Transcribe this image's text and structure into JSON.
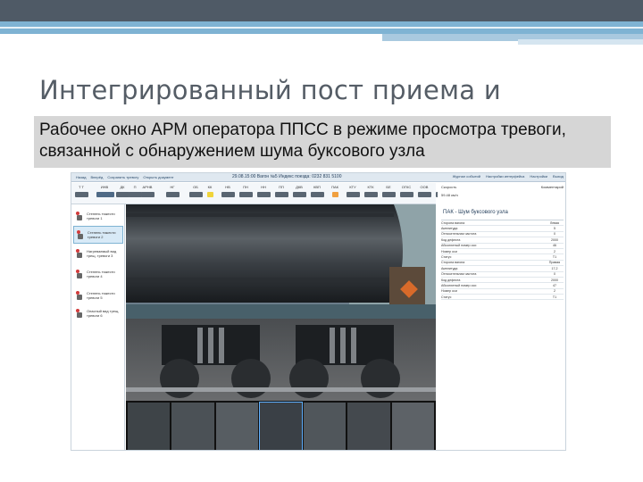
{
  "slide": {
    "title": "Интегрированный пост приема и",
    "subtitle_lines": [
      "Рабочее окно АРМ оператора ППСС в режиме просмотра тревоги,",
      "связанной с обнаружением шума буксового узла"
    ]
  },
  "app": {
    "title": "29.08.15:00 Вагон №5 Индекс поезда: 0232 831 5100",
    "toolbar_buttons": [
      "Назад",
      "Вперёд",
      "Сохранить тревогу",
      "Открыть документ"
    ],
    "toolbar_right": [
      "Журнал событий",
      "Настройки интерфейса",
      "Настройки",
      "Выход"
    ],
    "sensors": [
      {
        "label": "Т Т",
        "value": "dark"
      },
      {
        "label": "ИНВ",
        "value": "wide"
      },
      {
        "label": "ДК",
        "value": "dark"
      },
      {
        "label": "П",
        "value": "dark"
      },
      {
        "label": "АРНВ",
        "value": "dark"
      },
      {
        "label": "НГ",
        "value": "dark"
      },
      {
        "label": "ОБ",
        "value": "dark"
      },
      {
        "label": "КК",
        "value": "yellow"
      },
      {
        "label": "НВ",
        "value": "dark"
      },
      {
        "label": "ПН",
        "value": "dark"
      },
      {
        "label": "НН",
        "value": "dark"
      },
      {
        "label": "ПП",
        "value": "dark"
      },
      {
        "label": "ДКВ",
        "value": "dark"
      },
      {
        "label": "КВП",
        "value": "dark"
      },
      {
        "label": "ПАК",
        "value": "orange"
      },
      {
        "label": "КТУ",
        "value": "dark"
      },
      {
        "label": "КТК",
        "value": "dark"
      },
      {
        "label": "БЕ",
        "value": "dark"
      },
      {
        "label": "ОГКС",
        "value": "dark"
      },
      {
        "label": "ООВ",
        "value": "dark"
      },
      {
        "label": "СТД",
        "value": "dark"
      }
    ],
    "events": [
      {
        "text": "Степень тяжести тревоги 1"
      },
      {
        "text": "Степень тяжести тревоги 2"
      },
      {
        "text": "Нагреваемый вид трещ. тревоги 3"
      },
      {
        "text": "Степень тяжести тревоги 4"
      },
      {
        "text": "Степень тяжести тревоги 5"
      },
      {
        "text": "Опасный вид трещ. тревоги 6"
      }
    ],
    "right_panel": {
      "col_left": "Скорость",
      "col_right": "Комментарий",
      "speed": "59.48 км/ч",
      "title": "ПАК - Шум буксового узла",
      "rows": [
        {
          "k": "Сторона вагона",
          "v": "Левая"
        },
        {
          "k": "Амплитуда",
          "v": "5"
        },
        {
          "k": "Относительная частота",
          "v": "0"
        },
        {
          "k": "Код дефекта",
          "v": "2000"
        },
        {
          "k": "Абсолютный номер оси",
          "v": "46"
        },
        {
          "k": "Номер оси",
          "v": "2"
        },
        {
          "k": "Статус",
          "v": "Т1"
        },
        {
          "k": "Сторона вагона",
          "v": "Правая"
        },
        {
          "k": "Амплитуда",
          "v": "17,2"
        },
        {
          "k": "Относительная частота",
          "v": "0"
        },
        {
          "k": "Код дефекта",
          "v": "2000"
        },
        {
          "k": "Абсолютный номер оси",
          "v": "47"
        },
        {
          "k": "Номер оси",
          "v": "2"
        },
        {
          "k": "Статус",
          "v": "Т1"
        }
      ]
    }
  }
}
